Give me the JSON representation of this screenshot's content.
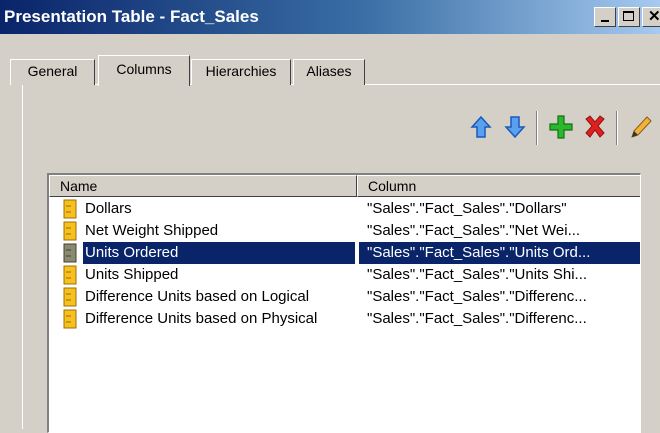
{
  "window": {
    "title": "Presentation Table - Fact_Sales",
    "buttons": [
      "minimize",
      "maximize",
      "close"
    ]
  },
  "tabs": [
    {
      "label": "General",
      "active": false
    },
    {
      "label": "Columns",
      "active": true
    },
    {
      "label": "Hierarchies",
      "active": false
    },
    {
      "label": "Aliases",
      "active": false
    }
  ],
  "toolbar": {
    "icons": [
      "arrow-up-icon",
      "arrow-down-icon",
      "add-icon",
      "delete-icon",
      "edit-pencil-icon"
    ],
    "colors": {
      "arrow": "#2a7ae2",
      "add": "#1ea31e",
      "delete": "#d62020",
      "edit": "#c07a10"
    }
  },
  "list": {
    "headers": {
      "name": "Name",
      "column": "Column"
    },
    "rows": [
      {
        "name": "Dollars",
        "column": "\"Sales\".\"Fact_Sales\".\"Dollars\"",
        "selected": false
      },
      {
        "name": "Net Weight Shipped",
        "column": "\"Sales\".\"Fact_Sales\".\"Net Wei...",
        "selected": false
      },
      {
        "name": "Units Ordered",
        "column": "\"Sales\".\"Fact_Sales\".\"Units Ord...",
        "selected": true
      },
      {
        "name": "Units Shipped",
        "column": "\"Sales\".\"Fact_Sales\".\"Units Shi...",
        "selected": false
      },
      {
        "name": "Difference Units based on Logical",
        "column": "\"Sales\".\"Fact_Sales\".\"Differenc...",
        "selected": false
      },
      {
        "name": "Difference Units based on Physical",
        "column": "\"Sales\".\"Fact_Sales\".\"Differenc...",
        "selected": false
      }
    ]
  },
  "colors": {
    "selection": "#0a246a",
    "titlebar": "#0a246a",
    "face": "#d4d0c8",
    "column_icon": "#f0b400"
  }
}
